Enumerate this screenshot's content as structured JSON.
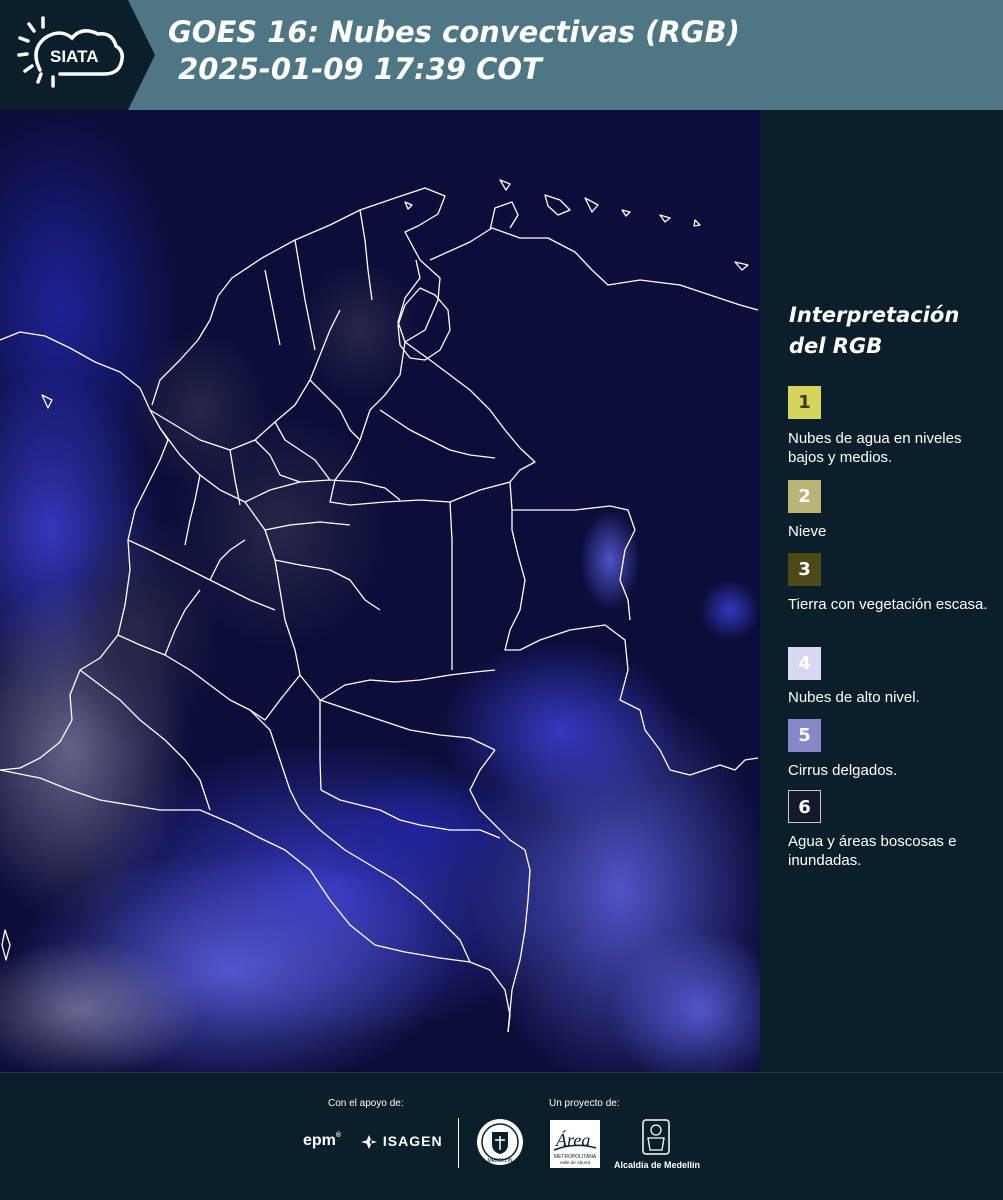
{
  "header": {
    "brand": "SIATA",
    "title": "GOES 16: Nubes convectivas (RGB)\n 2025-01-09 17:39 COT"
  },
  "legend": {
    "title": "Interpretación del RGB",
    "items": [
      {
        "num": "1",
        "label": "Nubes de agua en niveles bajos y medios.",
        "color": "#d6d45a",
        "numColor": "#3a3a10"
      },
      {
        "num": "2",
        "label": "Nieve",
        "color": "#b8b478",
        "numColor": "#ffffff"
      },
      {
        "num": "3",
        "label": "Tierra con vegetación escasa.",
        "color": "#4d4a19",
        "numColor": "#ffffff"
      },
      {
        "num": "4",
        "label": "Nubes de alto nivel.",
        "color": "#d8d8f4",
        "numColor": "#ffffff"
      },
      {
        "num": "5",
        "label": "Cirrus delgados.",
        "color": "#8988c6",
        "numColor": "#ffffff"
      },
      {
        "num": "6",
        "label": "Agua y áreas boscosas e inundadas.",
        "color": "#141a2c",
        "numColor": "#ffffff"
      }
    ]
  },
  "footer": {
    "support_label": "Con el apoyo de:",
    "project_label": "Un proyecto de:",
    "epm": "epm",
    "isagen": "ISAGEN",
    "medellin_seal": "MEDELLÍN",
    "area_logo": "Área",
    "area_sub": "METROPOLITANA",
    "area_sub2": "Valle de Aburrá",
    "alcaldia": "Alcaldía de Medellín"
  },
  "colors": {
    "header_bg": "#4e7684",
    "page_bg": "#0b1f2a",
    "map_ocean": "#0c0d3a"
  }
}
